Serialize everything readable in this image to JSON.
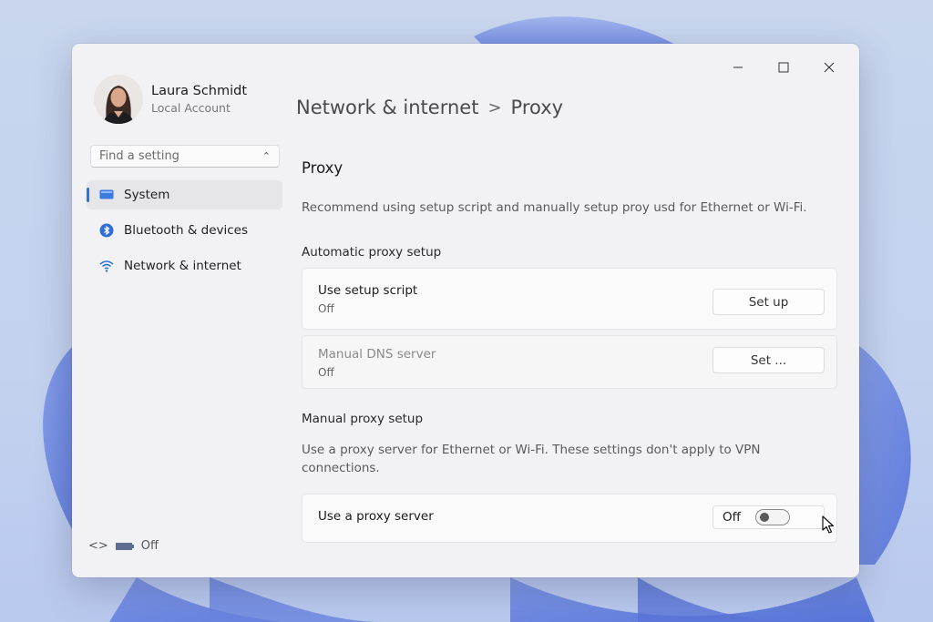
{
  "window": {
    "controls": [
      "minimize",
      "maximize",
      "close"
    ]
  },
  "user": {
    "name": "Laura Schmidt",
    "account_type": "Local Account"
  },
  "search": {
    "placeholder": "Find a setting"
  },
  "sidebar": {
    "items": [
      {
        "label": "System",
        "icon": "system-icon",
        "active": true
      },
      {
        "label": "Bluetooth & devices",
        "icon": "bluetooth-icon",
        "active": false
      },
      {
        "label": "Network & internet",
        "icon": "wifi-icon",
        "active": false
      }
    ],
    "footer_status": "Off"
  },
  "breadcrumb": {
    "parent": "Network & internet",
    "separator": ">",
    "current": "Proxy"
  },
  "page": {
    "title": "Proxy",
    "description": "Recommend using setup script and manually setup proy usd for Ethernet or Wi-Fi."
  },
  "automatic": {
    "heading": "Automatic proxy setup",
    "setup_script": {
      "title": "Use setup script",
      "status": "Off",
      "button": "Set up"
    },
    "dns_server": {
      "title": "Manual DNS server",
      "status": "Off",
      "button": "Set ..."
    }
  },
  "manual": {
    "heading": "Manual proxy setup",
    "description": "Use a proxy server for Ethernet or Wi-Fi. These settings don't apply to VPN connections.",
    "proxy_server": {
      "title": "Use a proxy server",
      "toggle_label": "Off",
      "toggle_on": false
    }
  },
  "colors": {
    "accent": "#3273d6",
    "window_bg": "#f2f2f4",
    "card_bg": "#fafafa"
  }
}
